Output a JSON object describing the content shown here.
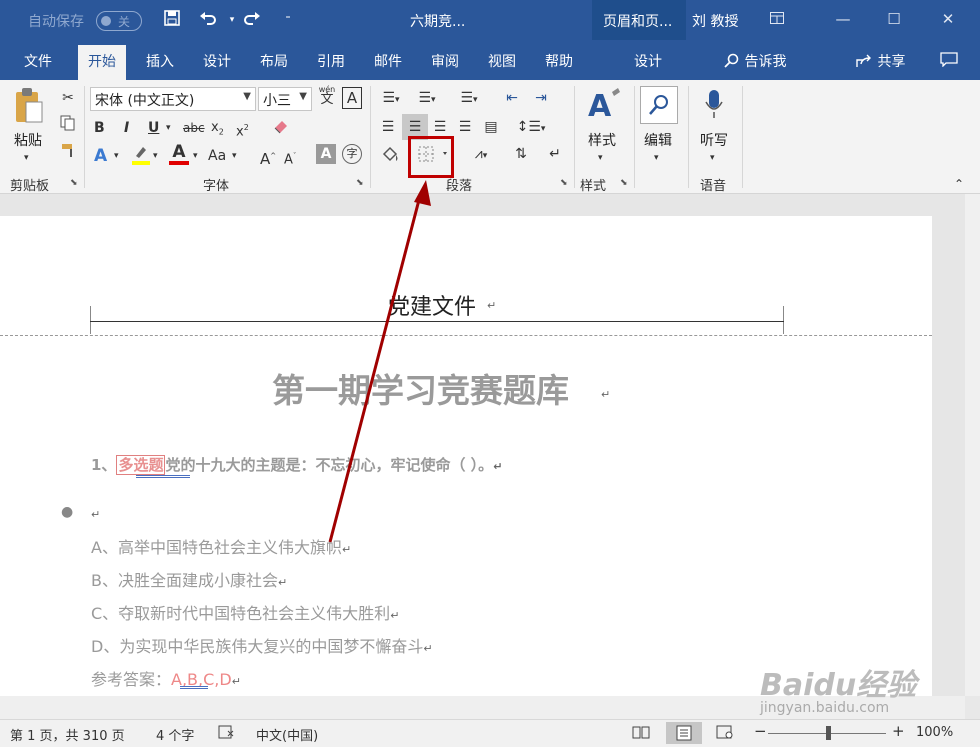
{
  "titlebar": {
    "autosave_label": "自动保存",
    "autosave_state": "关",
    "doc_title": "六期竞...",
    "context_title": "页眉和页...",
    "user": "刘 教授"
  },
  "tabs": {
    "file": "文件",
    "home": "开始",
    "insert": "插入",
    "design": "设计",
    "layout": "布局",
    "references": "引用",
    "mailings": "邮件",
    "review": "审阅",
    "view": "视图",
    "help": "帮助",
    "hf_design": "设计",
    "tell_me": "告诉我",
    "share": "共享"
  },
  "ribbon": {
    "clipboard": {
      "paste": "粘贴",
      "label": "剪贴板"
    },
    "font": {
      "name": "宋体 (中文正文)",
      "size": "小三",
      "label": "字体",
      "wen": "wén",
      "wen_char": "文",
      "box_a": "A"
    },
    "paragraph": {
      "label": "段落"
    },
    "styles": {
      "button": "样式",
      "label": "样式"
    },
    "editing": {
      "button": "编辑"
    },
    "voice": {
      "button": "听写",
      "label": "语音"
    }
  },
  "document": {
    "header_text": "党建文件",
    "title": "第一期学习竞赛题库",
    "question_no": "1、",
    "question_tag": "多选题",
    "question_text": "党的十九大的主题是：不忘初心，牢记使命（    ）。",
    "options": [
      "A、高举中国特色社会主义伟大旗帜",
      "B、决胜全面建成小康社会",
      "C、夺取新时代中国特色社会主义伟大胜利",
      "D、为实现中华民族伟大复兴的中国梦不懈奋斗"
    ],
    "answer_label": "参考答案：",
    "answer_value": "A,B,C,D"
  },
  "status": {
    "page": "第 1 页，共 310 页",
    "words": "4 个字",
    "language": "中文(中国)",
    "zoom": "100%"
  },
  "watermark": {
    "brand": "Baidu经验",
    "url": "jingyan.baidu.com"
  },
  "colors": {
    "brand_blue": "#2b579a",
    "highlight_red": "#c00000",
    "arrow": "#a00000"
  }
}
